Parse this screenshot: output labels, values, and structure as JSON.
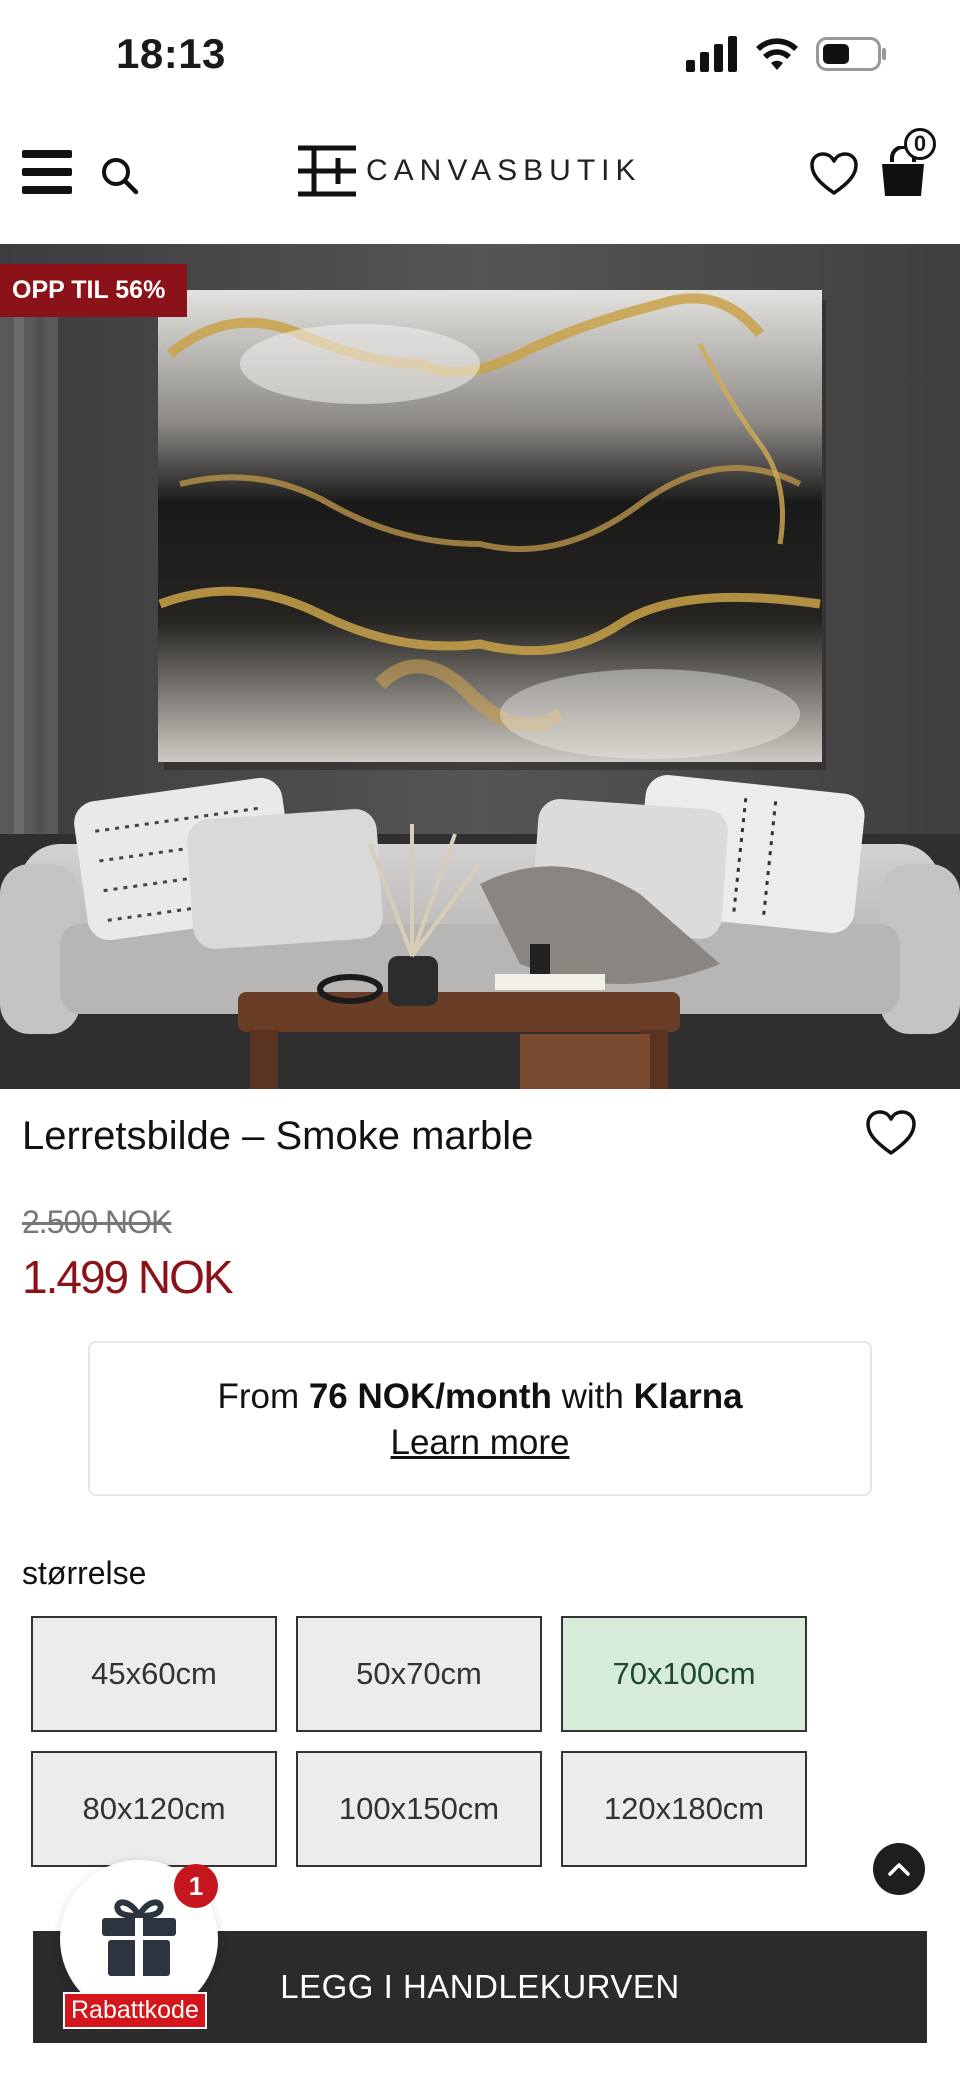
{
  "status_bar": {
    "time": "18:13"
  },
  "header": {
    "brand": "CANVASBUTIK",
    "cart_count": "0"
  },
  "hero": {
    "badge": "OPP TIL 56%"
  },
  "product": {
    "title": "Lerretsbilde – Smoke marble",
    "old_price": "2.500 NOK",
    "new_price": "1.499 NOK"
  },
  "klarna": {
    "prefix": "From ",
    "amount": "76 NOK/month",
    "middle": " with ",
    "brand": "Klarna",
    "link": "Learn more"
  },
  "sizes": {
    "label": "størrelse",
    "options": [
      "45x60cm",
      "50x70cm",
      "70x100cm",
      "80x120cm",
      "100x150cm",
      "120x180cm"
    ],
    "selected": "70x100cm"
  },
  "cta": {
    "label": "LEGG I HANDLEKURVEN"
  },
  "promo": {
    "count": "1",
    "label": "Rabattkode"
  },
  "colors": {
    "accent": "#8b1218",
    "selected_size": "#d6ecd8",
    "cta_bg": "#2b2b2d"
  }
}
